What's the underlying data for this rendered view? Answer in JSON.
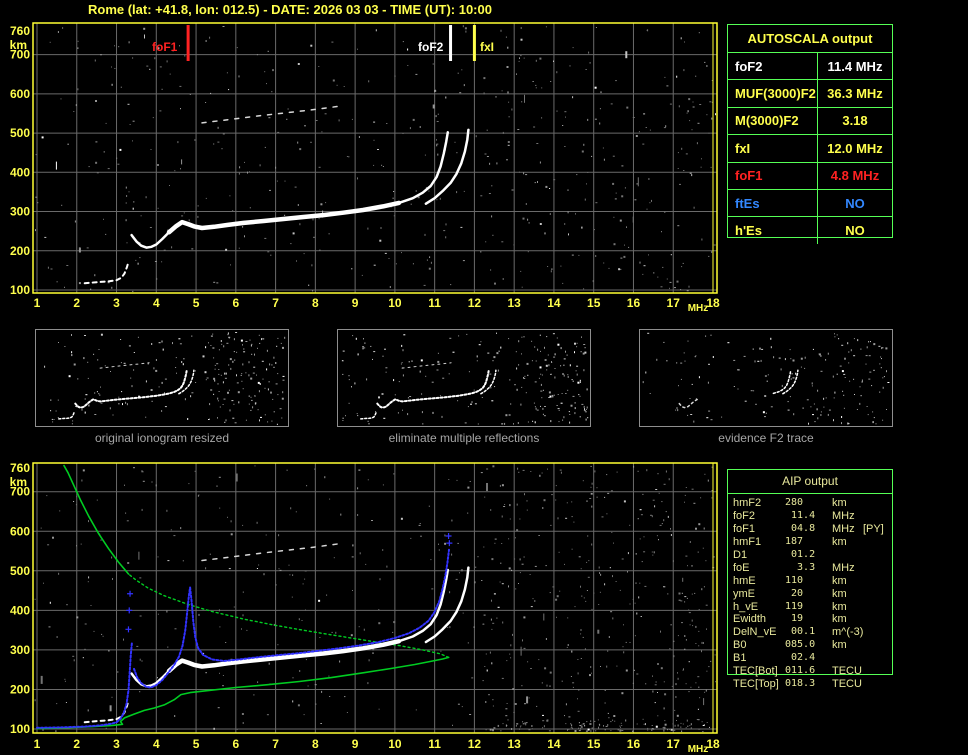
{
  "window": {
    "title": "Rome (lat: +41.8, lon: 012.5) - DATE: 2026 03 03 - TIME (UT): 10:00"
  },
  "colors": {
    "axis_text": "#ffff4d",
    "plot_border": "#ffff33",
    "grid": "#6a6a6a",
    "measured_trace": "#ffffff",
    "profile_green": "#00cc22",
    "reconstructed_blue": "#3232ff",
    "table_border_green": "#55ff55",
    "aip_text": "#e8e89c",
    "caption_gray": "#a6a6a6",
    "second_reflection": "#d8d8d8"
  },
  "axes": {
    "x_unit": "MHz",
    "y_unit": "km",
    "x_ticks": [
      1,
      2,
      3,
      4,
      5,
      6,
      7,
      8,
      9,
      10,
      11,
      12,
      13,
      14,
      15,
      16,
      17,
      18
    ],
    "y_ticks": [
      760,
      700,
      600,
      500,
      400,
      300,
      200,
      100
    ],
    "x_range": [
      1,
      18
    ],
    "y_range": [
      100,
      760
    ]
  },
  "markers": [
    {
      "label": "foF1",
      "freq": 4.8,
      "color": "#ff2222",
      "text_x": 152
    },
    {
      "label": "foF2",
      "freq": 11.4,
      "color": "#ffffff",
      "text_x": 418
    },
    {
      "label": "fxI",
      "freq": 12.0,
      "color": "#ffff4d",
      "text_x": 480
    }
  ],
  "chart_data": {
    "type": "scatter",
    "xlabel": "MHz",
    "ylabel": "km",
    "xlim": [
      1,
      18
    ],
    "ylim": [
      100,
      760
    ],
    "series": {
      "measured_trace": [
        [
          3.38,
          240
        ],
        [
          3.5,
          224
        ],
        [
          3.62,
          213
        ],
        [
          3.75,
          208
        ],
        [
          3.88,
          210
        ],
        [
          4.0,
          216
        ],
        [
          4.15,
          230
        ],
        [
          4.32,
          247
        ],
        [
          4.5,
          263
        ],
        [
          4.65,
          273
        ],
        [
          4.8,
          268
        ],
        [
          4.95,
          262
        ],
        [
          5.15,
          258
        ],
        [
          5.45,
          261
        ],
        [
          5.8,
          266
        ],
        [
          6.2,
          271
        ],
        [
          6.7,
          276
        ],
        [
          7.2,
          281
        ],
        [
          7.7,
          286
        ],
        [
          8.2,
          291
        ],
        [
          8.7,
          297
        ],
        [
          9.2,
          304
        ],
        [
          9.7,
          313
        ],
        [
          10.1,
          322
        ],
        [
          10.45,
          334
        ],
        [
          10.7,
          348
        ],
        [
          10.9,
          365
        ],
        [
          11.05,
          388
        ],
        [
          11.15,
          415
        ],
        [
          11.23,
          448
        ],
        [
          11.29,
          478
        ],
        [
          11.33,
          502
        ]
      ],
      "x_mode_branch": [
        [
          10.78,
          320
        ],
        [
          11.0,
          334
        ],
        [
          11.2,
          352
        ],
        [
          11.4,
          373
        ],
        [
          11.55,
          396
        ],
        [
          11.67,
          423
        ],
        [
          11.76,
          453
        ],
        [
          11.82,
          483
        ],
        [
          11.85,
          508
        ]
      ],
      "second_reflection": [
        [
          5.15,
          526
        ],
        [
          5.8,
          534
        ],
        [
          6.5,
          543
        ],
        [
          7.2,
          551
        ],
        [
          7.9,
          559
        ],
        [
          8.65,
          569
        ]
      ],
      "e_region_trace": [
        [
          2.2,
          117
        ],
        [
          2.5,
          120
        ],
        [
          2.8,
          122
        ],
        [
          3.0,
          125
        ],
        [
          3.12,
          131
        ],
        [
          3.2,
          142
        ],
        [
          3.26,
          158
        ],
        [
          3.3,
          172
        ]
      ],
      "profile_bottomside": [
        [
          1.0,
          101
        ],
        [
          1.7,
          103
        ],
        [
          2.4,
          106
        ],
        [
          2.9,
          109
        ],
        [
          3.15,
          112
        ],
        [
          3.1,
          119
        ],
        [
          3.2,
          128
        ],
        [
          3.45,
          138
        ],
        [
          3.7,
          147
        ],
        [
          3.95,
          153
        ],
        [
          4.2,
          161
        ],
        [
          4.45,
          174
        ],
        [
          4.62,
          187
        ],
        [
          4.85,
          192
        ],
        [
          5.3,
          197
        ],
        [
          6.0,
          205
        ],
        [
          6.8,
          212
        ],
        [
          7.6,
          220
        ],
        [
          8.4,
          230
        ],
        [
          9.2,
          242
        ],
        [
          9.9,
          253
        ],
        [
          10.5,
          263
        ],
        [
          10.9,
          271
        ],
        [
          11.2,
          277
        ],
        [
          11.35,
          281
        ]
      ],
      "profile_topside_dotted": [
        [
          11.35,
          281
        ],
        [
          11.15,
          290
        ],
        [
          10.7,
          300
        ],
        [
          10.1,
          311
        ],
        [
          9.4,
          322
        ],
        [
          8.6,
          335
        ],
        [
          7.8,
          348
        ],
        [
          7.0,
          362
        ],
        [
          6.2,
          378
        ],
        [
          5.4,
          397
        ],
        [
          4.8,
          415
        ],
        [
          4.2,
          437
        ],
        [
          3.8,
          456
        ],
        [
          3.5,
          476
        ],
        [
          3.3,
          492
        ]
      ],
      "profile_topside_solid": [
        [
          3.3,
          492
        ],
        [
          3.05,
          522
        ],
        [
          2.8,
          556
        ],
        [
          2.55,
          594
        ],
        [
          2.3,
          638
        ],
        [
          2.1,
          678
        ],
        [
          1.93,
          715
        ],
        [
          1.78,
          748
        ],
        [
          1.68,
          766
        ]
      ],
      "reconstructed_e": [
        [
          1.0,
          103
        ],
        [
          1.6,
          104
        ],
        [
          2.2,
          106
        ],
        [
          2.6,
          109
        ],
        [
          2.85,
          113
        ],
        [
          3.0,
          117
        ],
        [
          3.1,
          126
        ],
        [
          3.18,
          140
        ],
        [
          3.25,
          163
        ],
        [
          3.3,
          198
        ],
        [
          3.33,
          244
        ],
        [
          3.36,
          288
        ],
        [
          3.39,
          320
        ]
      ],
      "reconstructed_f": [
        [
          3.44,
          252
        ],
        [
          3.52,
          230
        ],
        [
          3.62,
          216
        ],
        [
          3.74,
          207
        ],
        [
          3.86,
          205
        ],
        [
          4.0,
          211
        ],
        [
          4.15,
          224
        ],
        [
          4.3,
          242
        ],
        [
          4.45,
          262
        ],
        [
          4.57,
          283
        ],
        [
          4.66,
          310
        ],
        [
          4.73,
          350
        ],
        [
          4.78,
          398
        ],
        [
          4.82,
          437
        ],
        [
          4.85,
          458
        ],
        [
          4.89,
          420
        ],
        [
          4.93,
          372
        ],
        [
          4.98,
          332
        ],
        [
          5.05,
          305
        ],
        [
          5.18,
          287
        ],
        [
          5.4,
          276
        ],
        [
          5.7,
          272
        ],
        [
          6.1,
          276
        ],
        [
          6.6,
          282
        ],
        [
          7.1,
          287
        ],
        [
          7.6,
          292
        ],
        [
          8.1,
          298
        ],
        [
          8.6,
          304
        ],
        [
          9.1,
          311
        ],
        [
          9.6,
          320
        ],
        [
          10.0,
          330
        ],
        [
          10.35,
          342
        ],
        [
          10.62,
          356
        ],
        [
          10.85,
          374
        ],
        [
          11.0,
          396
        ],
        [
          11.12,
          424
        ],
        [
          11.2,
          455
        ],
        [
          11.27,
          488
        ],
        [
          11.32,
          520
        ],
        [
          11.36,
          553
        ]
      ],
      "stray_blue_points": [
        [
          3.3,
          352
        ],
        [
          3.32,
          400
        ],
        [
          3.34,
          442
        ],
        [
          11.37,
          570
        ],
        [
          11.35,
          588
        ]
      ]
    }
  },
  "autoscala_table": {
    "header": "AUTOSCALA output",
    "header_color": "#ffff4d",
    "rows": [
      {
        "label": "foF2",
        "value": "11.4 MHz",
        "color": "#ffffff"
      },
      {
        "label": "MUF(3000)F2",
        "value": "36.3 MHz",
        "color": "#ffff4d"
      },
      {
        "label": "M(3000)F2",
        "value": "3.18",
        "color": "#ffff4d"
      },
      {
        "label": "fxI",
        "value": "12.0 MHz",
        "color": "#ffff4d"
      },
      {
        "label": "foF1",
        "value": "4.8 MHz",
        "color": "#ff2222"
      },
      {
        "label": "ftEs",
        "value": "NO",
        "color": "#3388ff"
      },
      {
        "label": "h'Es",
        "value": "NO",
        "color": "#ffff4d"
      }
    ]
  },
  "aip_table": {
    "header": "AIP output",
    "rows": [
      {
        "label": "hmF2",
        "value": "280",
        "unit": "km",
        "extra": ""
      },
      {
        "label": "foF2",
        "value": " 11.4",
        "unit": "MHz",
        "extra": ""
      },
      {
        "label": "foF1",
        "value": " 04.8",
        "unit": "MHz",
        "extra": "[PY]"
      },
      {
        "label": "hmF1",
        "value": "187",
        "unit": "km",
        "extra": ""
      },
      {
        "label": "D1",
        "value": " 01.2",
        "unit": "",
        "extra": ""
      },
      {
        "label": "foE",
        "value": "  3.3",
        "unit": "MHz",
        "extra": ""
      },
      {
        "label": "hmE",
        "value": "110",
        "unit": "km",
        "extra": ""
      },
      {
        "label": "ymE",
        "value": " 20",
        "unit": "km",
        "extra": ""
      },
      {
        "label": "h_vE",
        "value": "119",
        "unit": "km",
        "extra": ""
      },
      {
        "label": "Ewidth",
        "value": " 19",
        "unit": "km",
        "extra": ""
      },
      {
        "label": "DelN_vE",
        "value": " 00.1",
        "unit": "m^(-3)",
        "extra": ""
      },
      {
        "label": "B0",
        "value": "085.0",
        "unit": "km",
        "extra": ""
      },
      {
        "label": "B1",
        "value": " 02.4",
        "unit": "",
        "extra": ""
      },
      {
        "label": "TEC[Bot]",
        "value": "011.6",
        "unit": "TECU",
        "extra": ""
      },
      {
        "label": "TEC[Top]",
        "value": "018.3",
        "unit": "TECU",
        "extra": ""
      }
    ]
  },
  "thumbnails": [
    {
      "caption": "original ionogram resized"
    },
    {
      "caption": "eliminate multiple reflections"
    },
    {
      "caption": "evidence F2 trace"
    }
  ]
}
